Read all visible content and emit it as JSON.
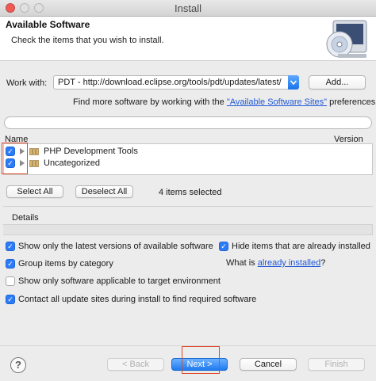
{
  "window": {
    "title": "Install"
  },
  "banner": {
    "title": "Available Software",
    "description": "Check the items that you wish to install."
  },
  "work_with": {
    "label": "Work with:",
    "value": "PDT - http://download.eclipse.org/tools/pdt/updates/latest/",
    "add_label": "Add...",
    "find_more_prefix": "Find more software by working with the ",
    "find_more_link": "\"Available Software Sites\"",
    "find_more_suffix": " preferences."
  },
  "filter": {
    "value": ""
  },
  "tree": {
    "columns": [
      "Name",
      "Version"
    ],
    "rows": [
      {
        "label": "PHP Development Tools",
        "checked": true
      },
      {
        "label": "Uncategorized",
        "checked": true
      }
    ]
  },
  "selection": {
    "select_all_label": "Select All",
    "deselect_all_label": "Deselect All",
    "count_text": "4 items selected"
  },
  "details": {
    "label": "Details"
  },
  "options": {
    "latest_versions": {
      "label": "Show only the latest versions of available software",
      "checked": true
    },
    "hide_installed": {
      "label": "Hide items that are already installed",
      "checked": true
    },
    "group_by_category": {
      "label": "Group items by category",
      "checked": true
    },
    "what_is_prefix": "What is ",
    "what_is_link": "already installed",
    "what_is_suffix": "?",
    "applicable_only": {
      "label": "Show only software applicable to target environment",
      "checked": false
    },
    "contact_sites": {
      "label": "Contact all update sites during install to find required software",
      "checked": true
    }
  },
  "footer": {
    "help_glyph": "?",
    "back_label": "< Back",
    "next_label": "Next >",
    "cancel_label": "Cancel",
    "finish_label": "Finish"
  },
  "colors": {
    "accent": "#2d7cf6",
    "annotation": "#e0492c",
    "link": "#2158d6",
    "close": "#ee5a55"
  }
}
